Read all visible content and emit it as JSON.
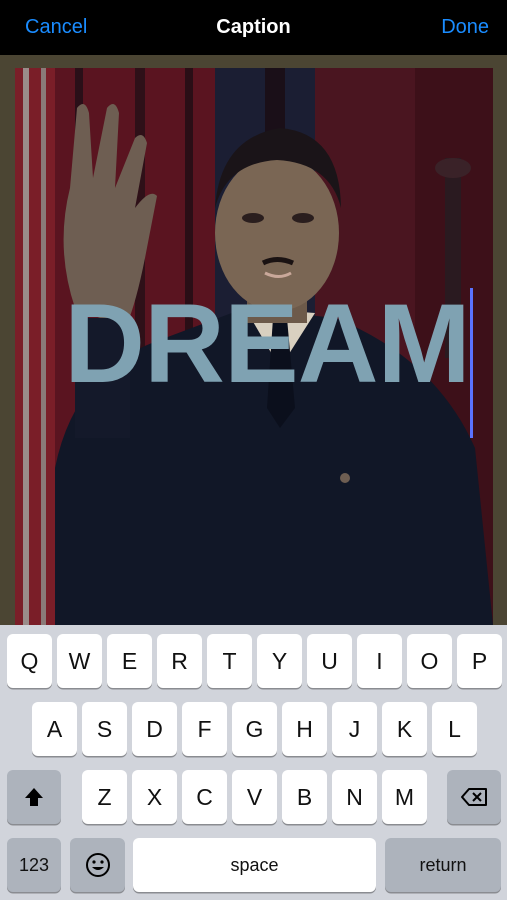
{
  "navbar": {
    "cancel_label": "Cancel",
    "title": "Caption",
    "done_label": "Done"
  },
  "editor": {
    "caption_text": "DREAM",
    "caption_color": "#7fa2b2",
    "cursor_color": "#5a73ff"
  },
  "keyboard": {
    "row1": [
      "Q",
      "W",
      "E",
      "R",
      "T",
      "Y",
      "U",
      "I",
      "O",
      "P"
    ],
    "row2": [
      "A",
      "S",
      "D",
      "F",
      "G",
      "H",
      "J",
      "K",
      "L"
    ],
    "row3": [
      "Z",
      "X",
      "C",
      "V",
      "B",
      "N",
      "M"
    ],
    "numbers_label": "123",
    "space_label": "space",
    "return_label": "return",
    "shift_icon": "shift-icon",
    "backspace_icon": "backspace-icon",
    "emoji_icon": "emoji-icon"
  },
  "colors": {
    "accent": "#1a8cff",
    "keyboard_bg": "#d1d4db",
    "key_dark": "#adb3bc"
  }
}
